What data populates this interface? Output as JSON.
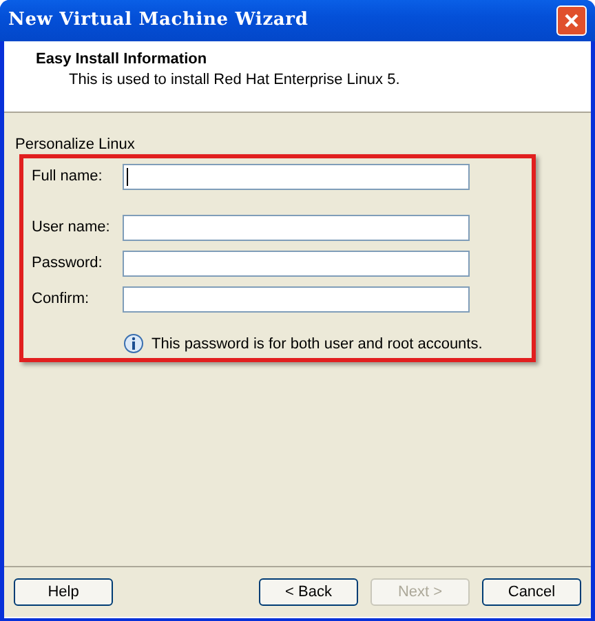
{
  "window": {
    "title": "New Virtual Machine Wizard"
  },
  "header": {
    "title": "Easy Install Information",
    "subtitle": "This is used to install Red Hat Enterprise Linux 5."
  },
  "section": {
    "title": "Personalize Linux"
  },
  "fields": [
    {
      "label": "Full name:",
      "focused": true
    },
    {
      "label": "User name:",
      "focused": false
    },
    {
      "label": "Password:",
      "focused": false
    },
    {
      "label": "Confirm:",
      "focused": false
    }
  ],
  "info": "This password is for both user and root accounts.",
  "buttons": [
    {
      "label": "Help",
      "disabled": false
    },
    {
      "label": "< Back",
      "disabled": false
    },
    {
      "label": "Next >",
      "disabled": true
    },
    {
      "label": "Cancel",
      "disabled": false
    }
  ]
}
